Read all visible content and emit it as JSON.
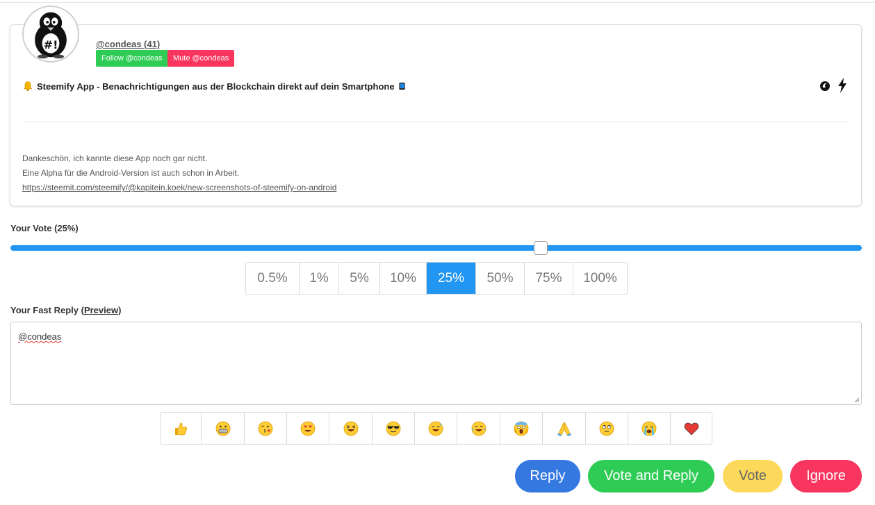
{
  "post": {
    "author": "@condeas (41)",
    "follow_label": "Follow @condeas",
    "mute_label": "Mute @condeas",
    "title": "Steemify App - Benachrichtigungen aus der Blockchain direkt auf dein Smartphone",
    "body_line1": "Dankeschön, ich kannte diese App noch gar nicht.",
    "body_line2": "Eine Alpha für die Android-Version ist auch schon in Arbeit.",
    "body_link": "https://steemit.com/steemify/@kapitein.koek/new-screenshots-of-steemify-on-android",
    "icons": [
      "bell-icon",
      "phone-icon",
      "steem-icon",
      "lightning-icon"
    ]
  },
  "vote": {
    "label": "Your Vote (25%)",
    "slider_value_percent": 25,
    "options": [
      "0.5%",
      "1%",
      "5%",
      "10%",
      "25%",
      "50%",
      "75%",
      "100%"
    ],
    "selected": "25%"
  },
  "reply": {
    "label_prefix": "Your Fast Reply (",
    "preview_label": "Preview",
    "label_suffix": ")",
    "text": "@condeas"
  },
  "emojis": [
    "thumbs-up",
    "grimacing-face",
    "face-blowing-kiss",
    "heart-eyes-face",
    "squinting-laugh-face",
    "sunglasses-face",
    "sweat-smile-face",
    "tears-of-joy-face",
    "screaming-face",
    "folded-hands",
    "eye-roll-face",
    "crying-face",
    "red-heart"
  ],
  "actions": {
    "reply": "Reply",
    "vote_and_reply": "Vote and Reply",
    "vote": "Vote",
    "ignore": "Ignore"
  },
  "colors": {
    "accent_blue": "#2196f3",
    "follow_green": "#2ecc55",
    "mute_red": "#f8355e",
    "reply_blue": "#3478e0",
    "vote_yellow": "#fcd95a"
  }
}
